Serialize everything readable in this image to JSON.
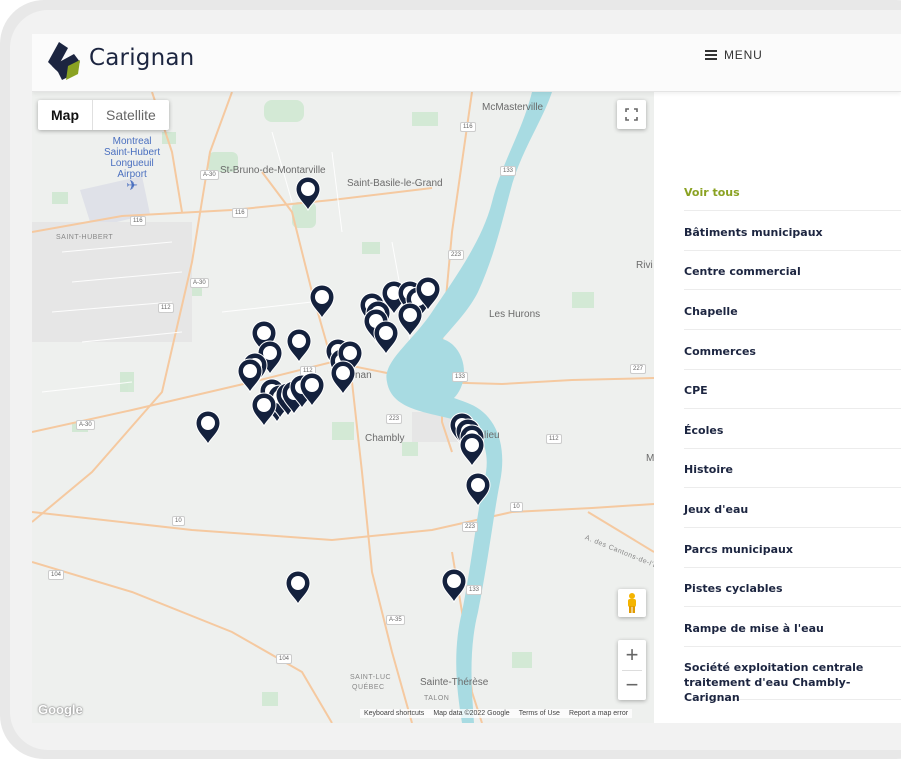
{
  "header": {
    "brand": "Carignan",
    "menu_label": "MENU"
  },
  "map": {
    "type_map": "Map",
    "type_satellite": "Satellite",
    "airport_line1": "Montreal",
    "airport_line2": "Saint-Hubert",
    "airport_line3": "Longueuil",
    "airport_line4": "Airport",
    "places": {
      "mcmasterville": "McMasterville",
      "st_bruno": "St-Bruno-de-Montarville",
      "st_basile": "Saint-Basile-le-Grand",
      "saint_hubert": "SAINT-HUBERT",
      "les_hurons": "Les Hurons",
      "rivi": "Rivi",
      "chambly": "Chambly",
      "nan": "nan",
      "lieu": "lieu",
      "m": "M",
      "est": "A. des Cantons-de-l'Est",
      "sainte_therese": "Sainte-Thérèse",
      "saint_luc": "SAINT-LUC",
      "quebec": "QUÉBEC",
      "talon": "TALON"
    },
    "shields": {
      "a30_top": "A-30",
      "r116_top": "116",
      "r116_left": "116",
      "r116_mid": "116",
      "r133_top": "133",
      "a30_mid": "A-30",
      "r112_left": "112",
      "r223_mid": "223",
      "r112_center": "112",
      "r133_right": "133",
      "r223_low": "223",
      "r227_right": "227",
      "a30_left": "A-30",
      "r112_right": "112",
      "r10_left": "10",
      "r10_right": "10",
      "r223_bottom": "223",
      "r104_left": "104",
      "r133_bottom": "133",
      "a35": "A-35",
      "r104_bottom": "104"
    },
    "footer": {
      "keyboard": "Keyboard shortcuts",
      "data": "Map data ©2022 Google",
      "terms": "Terms of Use",
      "report": "Report a map error"
    },
    "google_logo": "Google",
    "pin_color": "#14213d"
  },
  "sidebar": {
    "accent_color": "#8aa222",
    "items": [
      "Voir tous",
      "Bâtiments municipaux",
      "Centre commercial",
      "Chapelle",
      "Commerces",
      "CPE",
      "Écoles",
      "Histoire",
      "Jeux d'eau",
      "Parcs municipaux",
      "Pistes cyclables",
      "Rampe de mise à l'eau",
      "Société exploitation centrale traitement d'eau Chambly-Carignan"
    ]
  }
}
